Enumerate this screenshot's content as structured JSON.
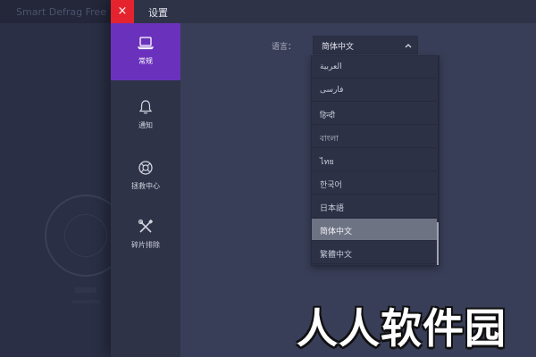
{
  "background_app": {
    "title": "Smart Defrag Free"
  },
  "panel": {
    "title": "设置",
    "close_label": "×"
  },
  "sidebar": {
    "items": [
      {
        "label": "常规",
        "icon": "laptop-icon",
        "active": true
      },
      {
        "label": "通知",
        "icon": "bell-icon",
        "active": false
      },
      {
        "label": "拯救中心",
        "icon": "lifebuoy-icon",
        "active": false
      },
      {
        "label": "碎片排除",
        "icon": "wrench-screwdriver-icon",
        "active": false
      }
    ]
  },
  "language": {
    "label": "语言：",
    "selected": "简体中文",
    "options": [
      "العربية",
      "فارسی",
      "हिन्दी",
      "বাংলা",
      "ไทย",
      "한국어",
      "日本語",
      "简体中文",
      "繁體中文"
    ]
  },
  "watermark": "人人软件园",
  "colors": {
    "accent": "#6a32bc",
    "close": "#e5232e",
    "selected_option": "#6e7384"
  }
}
